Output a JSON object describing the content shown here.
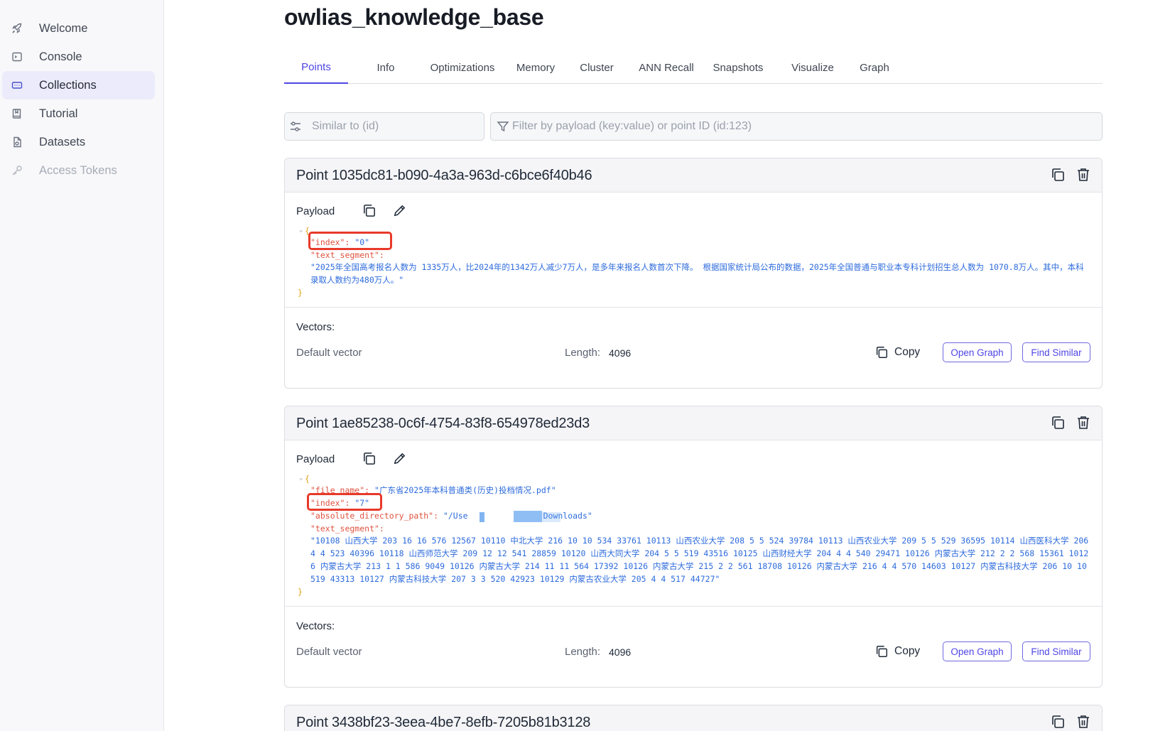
{
  "sidebar": {
    "items": [
      {
        "label": "Welcome",
        "icon": "rocket-icon",
        "active": false,
        "disabled": false
      },
      {
        "label": "Console",
        "icon": "terminal-icon",
        "active": false,
        "disabled": false
      },
      {
        "label": "Collections",
        "icon": "collection-icon",
        "active": true,
        "disabled": false
      },
      {
        "label": "Tutorial",
        "icon": "book-icon",
        "active": false,
        "disabled": false
      },
      {
        "label": "Datasets",
        "icon": "dataset-file-icon",
        "active": false,
        "disabled": false
      },
      {
        "label": "Access Tokens",
        "icon": "key-icon",
        "active": false,
        "disabled": true
      }
    ]
  },
  "collection": {
    "title": "owlias_knowledge_base"
  },
  "tabs": [
    {
      "label": "Points",
      "active": true
    },
    {
      "label": "Info"
    },
    {
      "label": "Optimizations"
    },
    {
      "label": "Memory"
    },
    {
      "label": "Cluster"
    },
    {
      "label": "ANN Recall"
    },
    {
      "label": "Snapshots"
    },
    {
      "label": "Visualize"
    },
    {
      "label": "Graph"
    }
  ],
  "search": {
    "similar_placeholder": "Similar to (id)",
    "filter_placeholder": "Filter by payload (key:value) or point ID (id:123)"
  },
  "labels": {
    "payload": "Payload",
    "vectors": "Vectors:",
    "length": "Length:",
    "copy": "Copy",
    "open_graph": "Open Graph",
    "find_similar": "Find Similar"
  },
  "points": [
    {
      "title": "Point 1035dc81-b090-4a3a-963d-c6bce6f40b46",
      "payload": {
        "open_brace": "{",
        "close_brace": "}",
        "index_key": "\"index\":",
        "index_value": "\"0\"",
        "text_segment_key": "\"text_segment\":",
        "text_segment_value": "\"2025年全国高考报名人数为 1335万人，比2024年的1342万人减少7万人，是多年来报名人数首次下降。 根据国家统计局公布的数据，2025年全国普通与职业本专科计划招生总人数为 1070.8万人。其中，本科录取人数约为480万人。\""
      },
      "vector": {
        "name": "Default vector",
        "length": "4096"
      }
    },
    {
      "title": "Point 1ae85238-0c6f-4754-83f8-654978ed23d3",
      "payload": {
        "open_brace": "{",
        "close_brace": "}",
        "file_name_key": "\"file_name\":",
        "file_name_value": "\"广东省2025年本科普通类(历史)投档情况.pdf\"",
        "index_key": "\"index\":",
        "index_value": "\"7\"",
        "abs_path_key": "\"absolute_directory_path\":",
        "abs_path_value_start": "\"/Use",
        "abs_path_value_end": "Downloads\"",
        "text_segment_key": "\"text_segment\":",
        "text_segment_value": "\"10108 山西大学 203 16 16 576 12567 10110 中北大学 216 10 10 534 33761 10113 山西农业大学 208 5 5 524 39784 10113 山西农业大学 209 5 5 529 36595 10114 山西医科大学 206 4 4 523 40396 10118 山西师范大学 209 12 12 541 28859 10120 山西大同大学 204 5 5 519 43516 10125 山西财经大学 204 4 4 540 29471 10126 内蒙古大学 212 2 2 568 15361 10126 内蒙古大学 213 1 1 586 9049 10126 内蒙古大学 214 11 11 564 17392 10126 内蒙古大学 215 2 2 561 18708 10126 内蒙古大学 216 4 4 570 14603 10127 内蒙古科技大学 206 10 10 519 43313 10127 内蒙古科技大学 207 3 3 520 42923 10129 内蒙古农业大学 205 4 4 517 44727\""
      },
      "vector": {
        "name": "Default vector",
        "length": "4096"
      }
    },
    {
      "title": "Point 3438bf23-3eea-4be7-8efb-7205b81b3128"
    }
  ],
  "colors": {
    "accent": "#4f46e5",
    "json_key": "#e0533f",
    "json_value": "#2d6bdc",
    "json_brace": "#e3a419",
    "highlight": "#e8392a"
  }
}
